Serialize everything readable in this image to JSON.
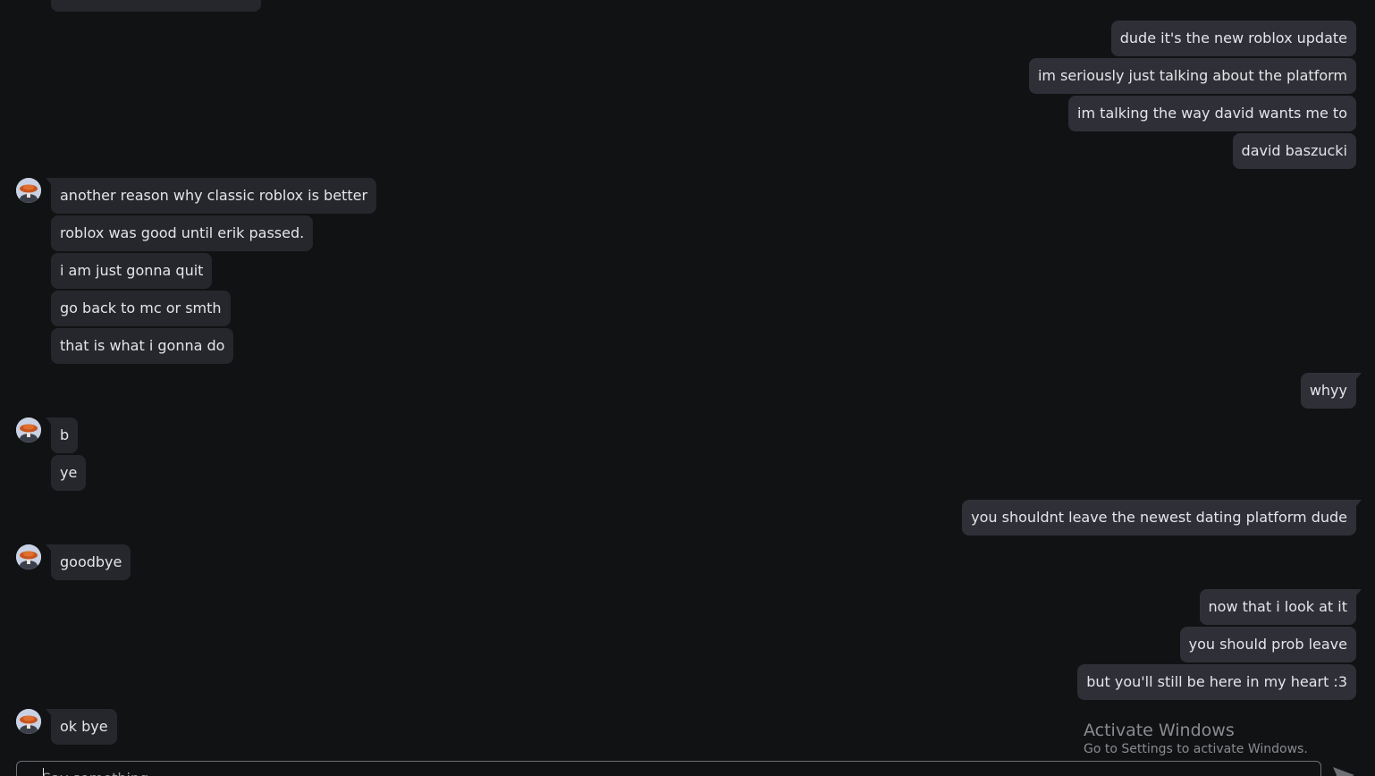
{
  "messages": [
    {
      "text": "dude it's the new roblox update",
      "dir": "out"
    },
    {
      "text": "im seriously just talking about the platform",
      "dir": "out"
    },
    {
      "text": "im talking the way david wants me to",
      "dir": "out"
    },
    {
      "text": "david baszucki",
      "dir": "out"
    },
    {
      "text": "another reason why classic roblox is better",
      "dir": "in"
    },
    {
      "text": "roblox was good until erik passed.",
      "dir": "in"
    },
    {
      "text": "i am just gonna quit",
      "dir": "in"
    },
    {
      "text": "go back to mc or smth",
      "dir": "in"
    },
    {
      "text": "that is what i gonna do",
      "dir": "in"
    },
    {
      "text": "whyy",
      "dir": "out"
    },
    {
      "text": "b",
      "dir": "in"
    },
    {
      "text": "ye",
      "dir": "in"
    },
    {
      "text": "you shouldnt leave the newest dating platform dude",
      "dir": "out"
    },
    {
      "text": "goodbye",
      "dir": "in"
    },
    {
      "text": "now that i look at it",
      "dir": "out"
    },
    {
      "text": "you should prob leave",
      "dir": "out"
    },
    {
      "text": "but you'll still be here in my heart :3",
      "dir": "out"
    },
    {
      "text": "ok bye",
      "dir": "in"
    }
  ],
  "composer": {
    "placeholder": "Say something..."
  },
  "watermark": {
    "title": "Activate Windows",
    "subtitle": "Go to Settings to activate Windows."
  },
  "icons": {
    "avatar": "user-avatar",
    "send": "send-icon"
  },
  "colors": {
    "background": "#111214",
    "incoming_bubble": "#26272c",
    "outgoing_bubble": "#2f3037",
    "text": "#e4e5e8"
  }
}
